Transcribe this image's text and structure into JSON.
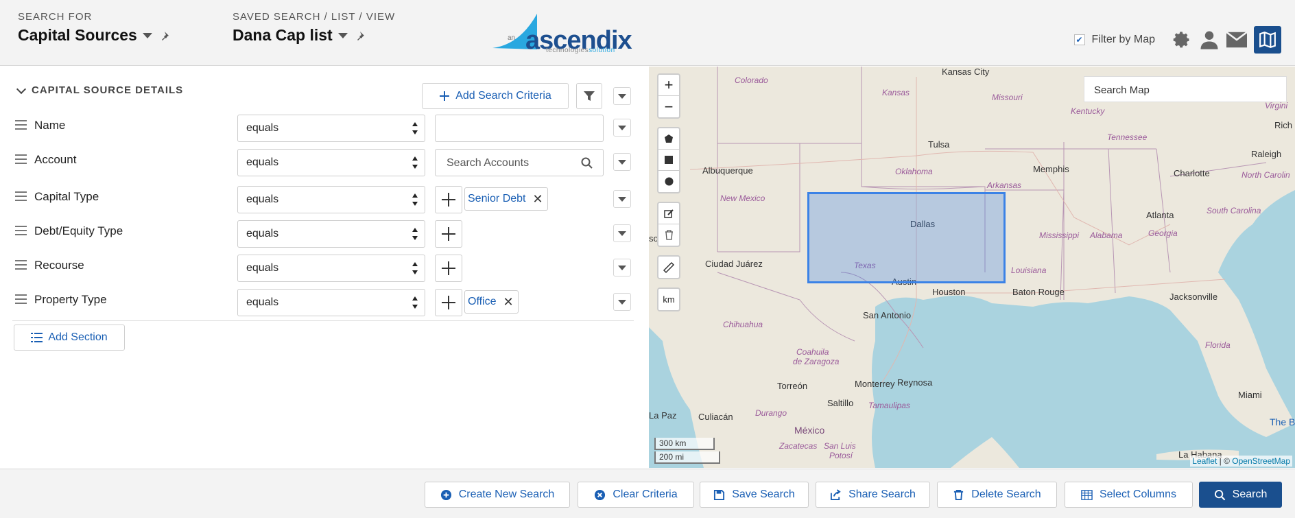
{
  "header": {
    "search_for_label": "SEARCH FOR",
    "search_for_value": "Capital Sources",
    "saved_search_label": "SAVED SEARCH / LIST / VIEW",
    "saved_search_value": "Dana Cap list",
    "logo": {
      "prefix": "an",
      "name": "ascendix",
      "sub_a": "technologies",
      "sub_b": "solution"
    },
    "filter_by_map_label": "Filter by Map",
    "filter_by_map_checked": true
  },
  "criteria": {
    "section_title": "CAPITAL SOURCE DETAILS",
    "add_criteria_label": "Add Search Criteria",
    "add_section_label": "Add Section",
    "rows": [
      {
        "label": "Name",
        "operator": "equals",
        "value": ""
      },
      {
        "label": "Account",
        "operator": "equals",
        "placeholder": "Search Accounts"
      },
      {
        "label": "Capital Type",
        "operator": "equals",
        "tag": "Senior Debt"
      },
      {
        "label": "Debt/Equity Type",
        "operator": "equals"
      },
      {
        "label": "Recourse",
        "operator": "equals"
      },
      {
        "label": "Property Type",
        "operator": "equals",
        "tag": "Office"
      }
    ]
  },
  "map": {
    "search_placeholder": "Search Map",
    "zoom_in": "+",
    "zoom_out": "−",
    "unit_toggle": "km",
    "scale_km": "300 km",
    "scale_mi": "200 mi",
    "attribution_a": "Leaflet",
    "attribution_sep": " | © ",
    "attribution_b": "OpenStreetMap",
    "labels": {
      "kansas_city": "Kansas City",
      "colorado": "Colorado",
      "kansas": "Kansas",
      "missouri": "Missouri",
      "kentucky": "Kentucky",
      "virginia": "Virgini",
      "richmond": "Rich",
      "tulsa": "Tulsa",
      "albuquerque": "Albuquerque",
      "oklahoma": "Oklahoma",
      "memphis": "Memphis",
      "tennessee": "Tennessee",
      "charlotte": "Charlotte",
      "raleigh": "Raleigh",
      "north_carolina": "North Carolin",
      "new_mexico": "New Mexico",
      "arkansas": "Arkansas",
      "dallas": "Dallas",
      "atlanta": "Atlanta",
      "south_carolina": "South Carolina",
      "mississippi": "Mississippi",
      "alabama": "Alabama",
      "georgia": "Georgia",
      "ciudad_juarez": "Ciudad Juárez",
      "texas": "Texas",
      "louisiana": "Louisiana",
      "austin": "Austin",
      "houston": "Houston",
      "baton_rouge": "Baton Rouge",
      "jacksonville": "Jacksonville",
      "san_antonio": "San Antonio",
      "chihuahua": "Chihuahua",
      "florida": "Florida",
      "coahuila": "Coahuila",
      "de_zaragoza": "de Zaragoza",
      "torreon": "Torreón",
      "monterrey": "Monterrey",
      "reynosa": "Reynosa",
      "saltillo": "Saltillo",
      "tamaulipas": "Tamaulipas",
      "miami": "Miami",
      "la_paz": "La Paz",
      "culiacan": "Culiacán",
      "durango": "Durango",
      "mexico": "México",
      "zacatecas": "Zacatecas",
      "san_luis": "San Luis",
      "potosi": "Potosí",
      "la_habana": "La Habana",
      "bahamas": "The B",
      "so": "so"
    }
  },
  "footer": {
    "create_new_search": "Create New Search",
    "clear_criteria": "Clear Criteria",
    "save_search": "Save Search",
    "share_search": "Share Search",
    "delete_search": "Delete Search",
    "select_columns": "Select Columns",
    "search": "Search"
  },
  "colors": {
    "brand": "#1a4f8e",
    "link": "#1a5fb4",
    "selection": "#3b82e6",
    "water": "#aad3df",
    "land": "#ece8dd"
  },
  "icons": [
    "pin-icon",
    "gear-icon",
    "user-icon",
    "mail-icon",
    "map-toggle-icon",
    "chevron-down-icon",
    "plus-icon",
    "filter-icon",
    "search-icon",
    "close-icon",
    "drag-handle-icon",
    "polygon-icon",
    "square-icon",
    "circle-icon",
    "edit-icon",
    "trash-icon",
    "ruler-icon",
    "list-icon",
    "save-icon",
    "share-icon"
  ]
}
